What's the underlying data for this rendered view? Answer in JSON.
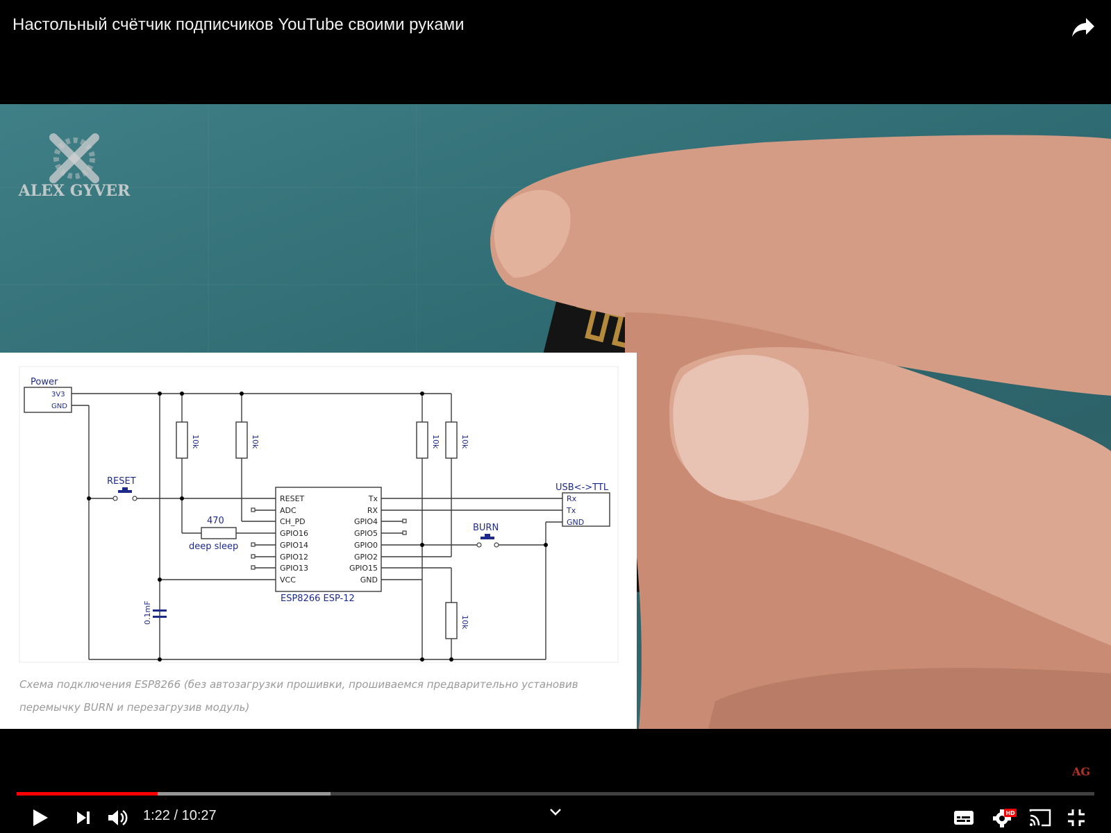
{
  "header": {
    "title": "Настольный счётчик подписчиков YouTube своими руками",
    "share_icon": "share-arrow-icon"
  },
  "video": {
    "watermark_text": "ALEX GYVER"
  },
  "schematic": {
    "caption": "Схема подключения ESP8266 (без автозагрузки прошивки, прошиваемся предварительно установив перемычку BURN и перезагрузив модуль)",
    "labels": {
      "power": "Power",
      "v33": "3V3",
      "gnd": "GND",
      "reset": "RESET",
      "burn": "BURN",
      "usb_ttl": "USB<->TTL",
      "rx": "Rx",
      "tx": "Tx",
      "gnd_ttl": "GND",
      "r470": "470",
      "deep_sleep": "deep  sleep",
      "cap": "0.1mF",
      "r10k_1": "10k",
      "r10k_2": "10k",
      "r10k_3": "10k",
      "r10k_4": "10k",
      "r10k_5": "10k",
      "chip_name": "ESP8266  ESP-12",
      "pin_reset": "RESET",
      "pin_adc": "ADC",
      "pin_chpd": "CH_PD",
      "pin_gpio16": "GPIO16",
      "pin_gpio14": "GPIO14",
      "pin_gpio12": "GPIO12",
      "pin_gpio13": "GPIO13",
      "pin_vcc": "VCC",
      "pin_tx": "Tx",
      "pin_rx": "RX",
      "pin_gpio4": "GPIO4",
      "pin_gpio5": "GPIO5",
      "pin_gpio0": "GPIO0",
      "pin_gpio2": "GPIO2",
      "pin_gpio15": "GPIO15",
      "pin_gnd": "GND"
    }
  },
  "player": {
    "time_current": "1:22",
    "time_separator": " / ",
    "time_total": "10:27",
    "played_fraction": 0.131,
    "buffered_fraction": 0.291,
    "ag_badge": "AG",
    "hd_badge": "HD",
    "accent_color": "#ff0000"
  }
}
